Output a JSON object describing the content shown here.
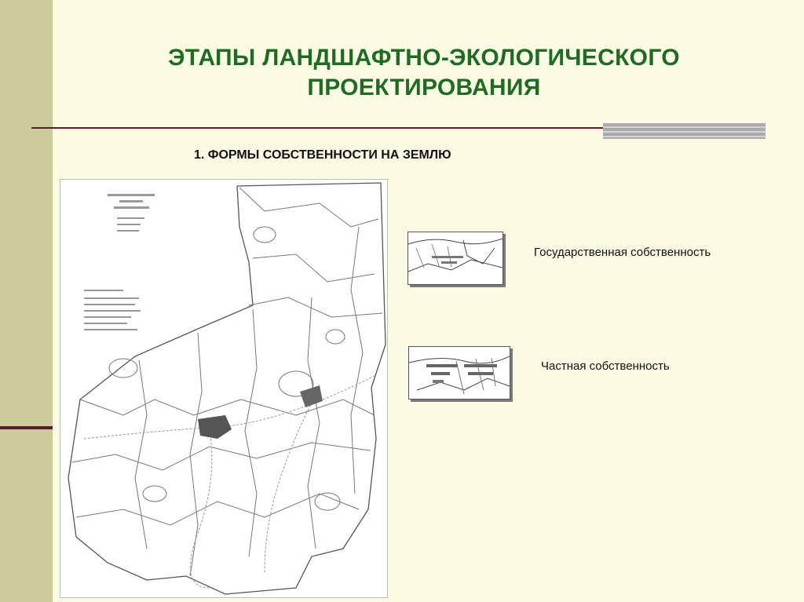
{
  "slide": {
    "title_line1": "ЭТАПЫ ЛАНДШАФТНО-ЭКОЛОГИЧЕСКОГО",
    "title_line2": "ПРОЕКТИРОВАНИЯ",
    "subtitle": "1. ФОРМЫ СОБСТВЕННОСТИ НА ЗЕМЛЮ",
    "captions": {
      "state": "Государственная собственность",
      "private": "Частная собственность"
    },
    "colors": {
      "background": "#fbfbe4",
      "sidebar": "#cbcb9c",
      "title": "#1e6b23",
      "rule": "#5a1a36"
    }
  }
}
